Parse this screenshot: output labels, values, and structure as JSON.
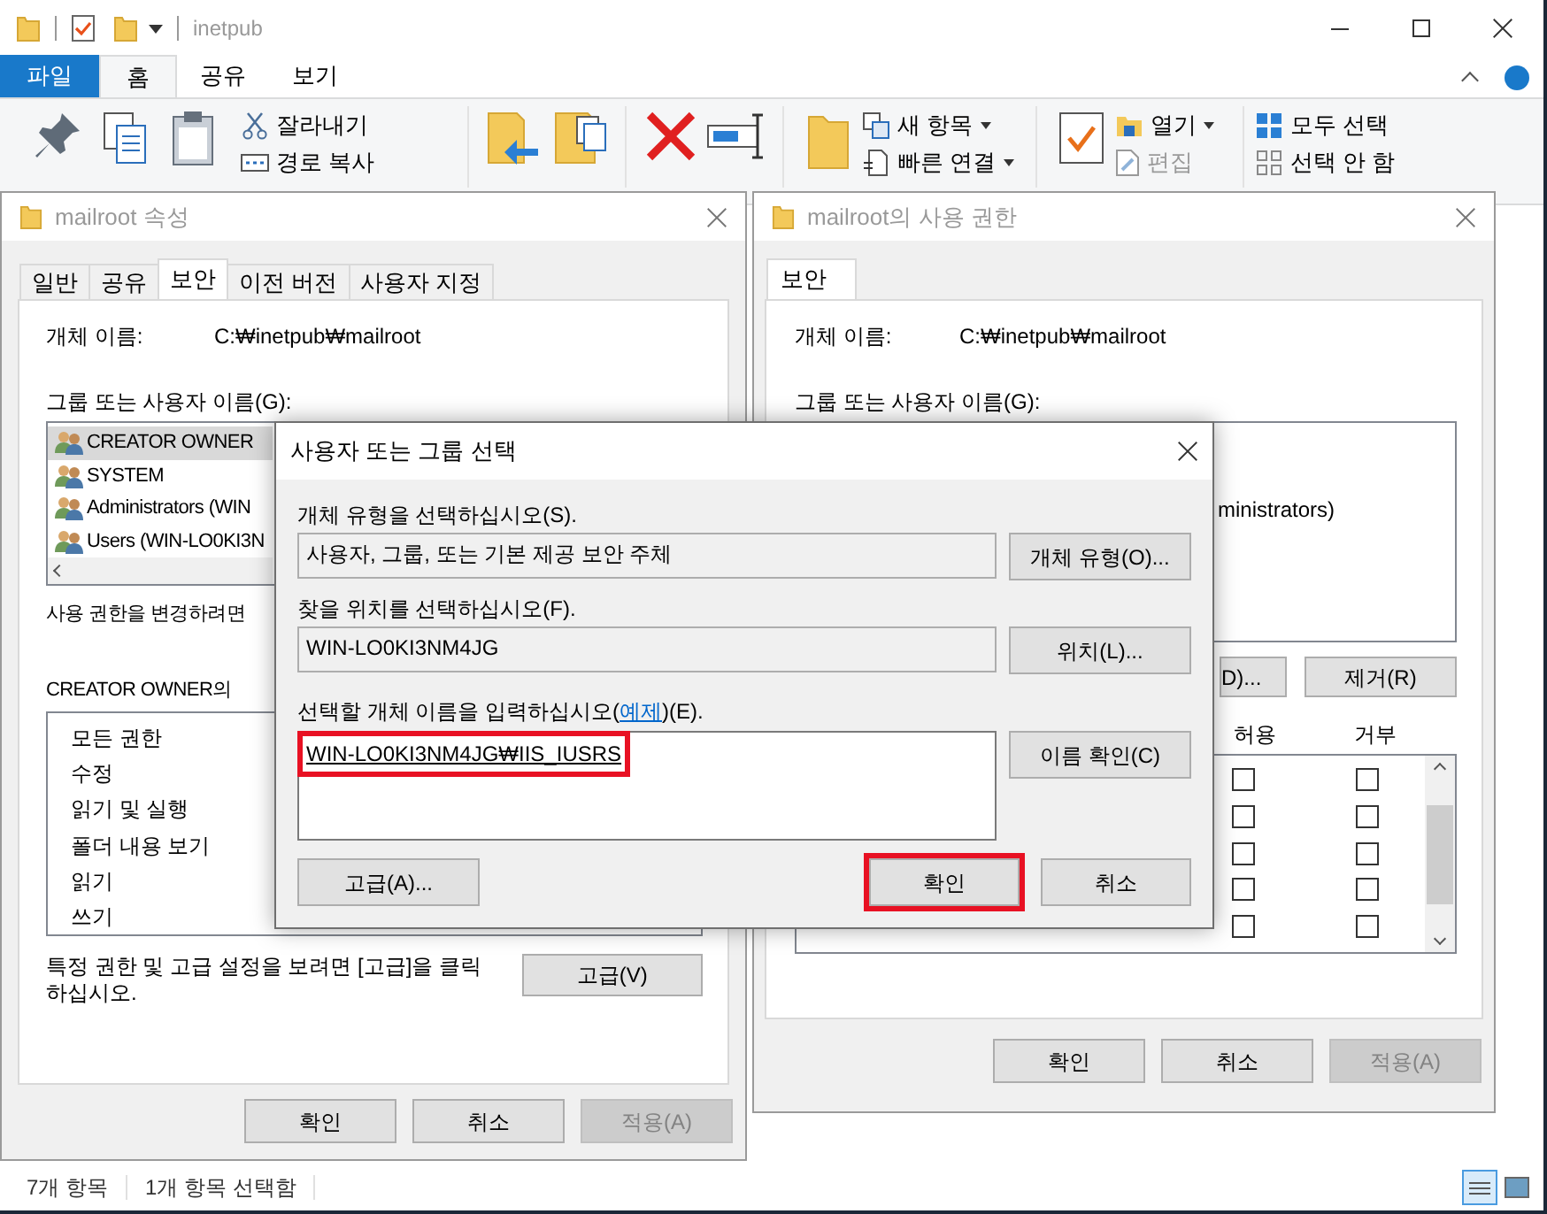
{
  "explorer": {
    "title": "inetpub",
    "tabs": [
      {
        "label": "파일",
        "kind": "file",
        "selected": false
      },
      {
        "label": "홈",
        "kind": "tab",
        "selected": true
      },
      {
        "label": "공유",
        "kind": "tab",
        "selected": false
      },
      {
        "label": "보기",
        "kind": "tab",
        "selected": false
      }
    ],
    "ribbon": {
      "clipboard": [
        {
          "label": "잘라내기",
          "dropdown": false,
          "disabled": false
        },
        {
          "label": "경로 복사",
          "dropdown": false,
          "disabled": false
        }
      ],
      "new": [
        {
          "label": "새 항목",
          "dropdown": true,
          "disabled": false
        },
        {
          "label": "빠른 연결",
          "dropdown": true,
          "disabled": false
        }
      ],
      "open": [
        {
          "label": "열기",
          "dropdown": true,
          "disabled": false
        },
        {
          "label": "편집",
          "dropdown": false,
          "disabled": true
        }
      ],
      "select": [
        {
          "label": "모두 선택",
          "dropdown": false,
          "disabled": false
        },
        {
          "label": "선택 안 함",
          "dropdown": false,
          "disabled": false
        }
      ]
    },
    "status": [
      "7개 항목",
      "1개 항목 선택함"
    ]
  },
  "properties": {
    "title": "mailroot 속성",
    "tabs": [
      {
        "label": "일반",
        "selected": false
      },
      {
        "label": "공유",
        "selected": false
      },
      {
        "label": "보안",
        "selected": true
      },
      {
        "label": "이전 버전",
        "selected": false
      },
      {
        "label": "사용자 지정",
        "selected": false
      }
    ],
    "object_label": "개체 이름:",
    "object_value": "C:₩inetpub₩mailroot",
    "group_label": "그룹 또는 사용자 이름(G):",
    "users": [
      {
        "name": "CREATOR OWNER",
        "selected": true
      },
      {
        "name": "SYSTEM",
        "selected": false
      },
      {
        "name": "Administrators (WIN",
        "selected": false
      },
      {
        "name": "Users (WIN-LO0KI3N",
        "selected": false
      }
    ],
    "change_hint": "사용 권한을 변경하려면",
    "perm_label": "CREATOR OWNER의",
    "permissions": [
      "모든 권한",
      "수정",
      "읽기 및 실행",
      "폴더 내용 보기",
      "읽기",
      "쓰기"
    ],
    "advanced_hint": "특정 권한 및 고급 설정을 보려면 [고급]을 클릭 하십시오.",
    "advanced_button": "고급(V)",
    "buttons": [
      {
        "label": "확인",
        "disabled": false
      },
      {
        "label": "취소",
        "disabled": false
      },
      {
        "label": "적용(A)",
        "disabled": true
      }
    ]
  },
  "permissions_dialog": {
    "title": "mailroot의 사용 권한",
    "tabs": [
      {
        "label": "보안",
        "selected": true
      }
    ],
    "object_label": "개체 이름:",
    "object_value": "C:₩inetpub₩mailroot",
    "group_label": "그룹 또는 사용자 이름(G):",
    "user_fragment": "ministrators)",
    "add_button": "D)...",
    "remove_button": "제거(R)",
    "columns": [
      "허용",
      "거부"
    ],
    "rows": [
      {
        "allow": false,
        "deny": false
      },
      {
        "allow": false,
        "deny": false
      },
      {
        "allow": false,
        "deny": false
      },
      {
        "allow": false,
        "deny": false
      },
      {
        "allow": false,
        "deny": false
      }
    ],
    "buttons": [
      {
        "label": "확인",
        "disabled": false
      },
      {
        "label": "취소",
        "disabled": false
      },
      {
        "label": "적용(A)",
        "disabled": true
      }
    ]
  },
  "select_dialog": {
    "title": "사용자 또는 그룹 선택",
    "object_type_label": "개체 유형을 선택하십시오(S).",
    "object_type_value": "사용자, 그룹, 또는 기본 제공 보안 주체",
    "object_type_button": "개체 유형(O)...",
    "location_label": "찾을 위치를 선택하십시오(F).",
    "location_value": "WIN-LO0KI3NM4JG",
    "location_button": "위치(L)...",
    "name_label": "선택할 개체 이름을 입력하십시오(",
    "name_link": "예제",
    "name_label_end": ")(E).",
    "name_value": "WIN-LO0KI3NM4JG₩IIS_IUSRS",
    "name_resolved": true,
    "name_highlighted": true,
    "check_button": "이름 확인(C)",
    "advanced_button": "고급(A)...",
    "buttons": [
      {
        "label": "확인",
        "highlighted": true
      },
      {
        "label": "취소",
        "highlighted": false
      }
    ]
  }
}
